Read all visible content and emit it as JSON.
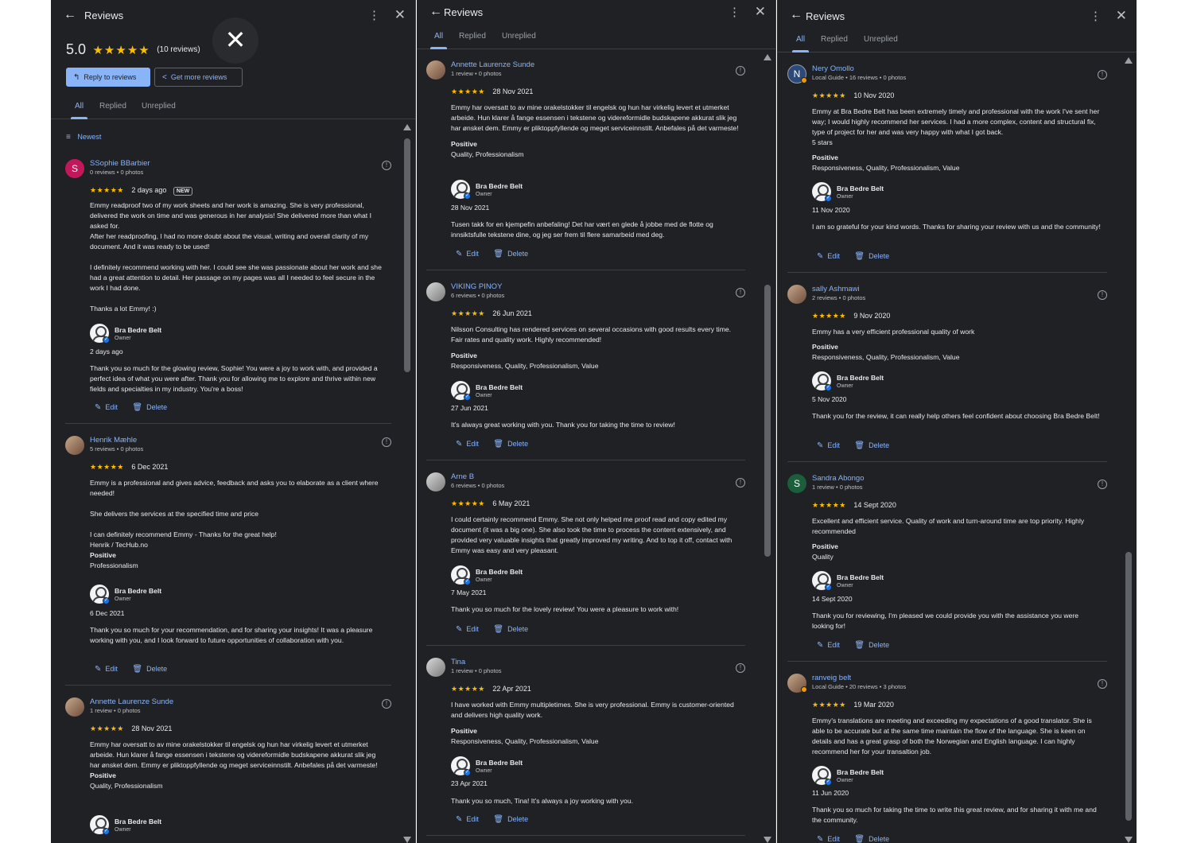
{
  "panel1": {
    "title": "Reviews",
    "icons": {
      "back": "←",
      "more": "⋮",
      "close": "✕"
    },
    "summary": {
      "score": "5.0",
      "stars": "★★★★★",
      "count": "(10 reviews)"
    },
    "buttons": {
      "reply": "Reply to reviews",
      "get_more": "Get more reviews"
    },
    "overlay_close": "✕",
    "tabs": [
      "All",
      "Replied",
      "Unreplied"
    ],
    "sort_label": "Newest",
    "reviews": [
      {
        "initial": "S",
        "name": "SSophie BBarbier",
        "meta": "0 reviews • 0 photos",
        "stars": "★★★★★",
        "date": "2 days ago",
        "badge": "NEW",
        "text1": "Emmy readproof two of my work sheets and her work is amazing. She is very professional, delivered the work on time and was generous in her analysis! She delivered more than what I asked for.",
        "text2": "After her readproofing, I had no more doubt about the visual, writing and overall clarity of my document. And it was ready to be used!",
        "text3": "I definitely recommend working with her. I could see she was passionate about her work and she had a great attention to detail. Her passage on my pages was all I needed to feel secure in the work I had done.",
        "text4": "Thanks a lot Emmy! :)",
        "owner": "Bra Bedre Belt",
        "owner_role": "Owner",
        "reply_date": "2 days ago",
        "reply": "Thank you so much for the glowing review, Sophie! You were a joy to work with, and provided a perfect idea of what you were after. Thank you for allowing me to explore and thrive within new fields and specialties in my industry. You're a boss!",
        "edit": "Edit",
        "delete": "Delete"
      },
      {
        "name": "Henrik Mæhle",
        "meta": "5 reviews • 0 photos",
        "stars": "★★★★★",
        "date": "6 Dec 2021",
        "text1": "Emmy is a professional and gives advice, feedback and asks you to elaborate as a client where needed!",
        "text2": "She delivers the services at the specified time and price",
        "text3": "I can definitely recommend Emmy - Thanks for the great help!",
        "text4": "Henrik / TecHub.no",
        "positive_label": "Positive",
        "positive": "Professionalism",
        "owner": "Bra Bedre Belt",
        "owner_role": "Owner",
        "reply_date": "6 Dec 2021",
        "reply": "Thank you so much for your recommendation, and for sharing your insights! It was a pleasure working with you, and I look forward to future opportunities of collaboration with you.",
        "edit": "Edit",
        "delete": "Delete"
      },
      {
        "name": "Annette Laurenze Sunde",
        "meta": "1 review • 0 photos",
        "stars": "★★★★★",
        "date": "28 Nov 2021",
        "text1": "Emmy har oversatt to av mine orakelstokker til engelsk og hun har virkelig levert et utmerket arbeide. Hun klarer å fange essensen i tekstene og videreformidle budskapene akkurat slik jeg har ønsket dem. Emmy er pliktoppfyllende og meget serviceinnstilt. Anbefales på det varmeste!",
        "positive_label": "Positive",
        "positive": "Quality, Professionalism",
        "owner": "Bra Bedre Belt",
        "owner_role": "Owner"
      }
    ]
  },
  "panel2": {
    "title": "Reviews",
    "icons": {
      "back": "←",
      "more": "⋮",
      "close": "✕"
    },
    "tabs": [
      "All",
      "Replied",
      "Unreplied"
    ],
    "reviews": [
      {
        "name": "Annette Laurenze Sunde",
        "meta": "1 review • 0 photos",
        "stars": "★★★★★",
        "date": "28 Nov 2021",
        "text1": "Emmy har oversatt to av mine orakelstokker til engelsk og hun har virkelig levert et utmerket arbeide. Hun klarer å fange essensen i tekstene og videreformidle budskapene akkurat slik jeg har ønsket dem. Emmy er pliktoppfyllende og meget serviceinnstilt. Anbefales på det varmeste!",
        "positive_label": "Positive",
        "positive": "Quality, Professionalism",
        "owner": "Bra Bedre Belt",
        "owner_role": "Owner",
        "reply_date": "28 Nov 2021",
        "reply": "Tusen takk for en kjempefin anbefaling! Det har vært en glede å jobbe med de flotte og innsiktsfulle tekstene dine, og jeg ser frem til flere samarbeid med deg.",
        "edit": "Edit",
        "delete": "Delete"
      },
      {
        "name": "VIKING PINOY",
        "meta": "6 reviews • 0 photos",
        "stars": "★★★★★",
        "date": "26 Jun 2021",
        "text1": "Nilsson Consulting has rendered services on several occasions with good results every time. Fair rates and quality work. Highly recommended!",
        "positive_label": "Positive",
        "positive": "Responsiveness, Quality, Professionalism, Value",
        "owner": "Bra Bedre Belt",
        "owner_role": "Owner",
        "reply_date": "27 Jun 2021",
        "reply": "It's always great working with you. Thank you for taking the time to review!",
        "edit": "Edit",
        "delete": "Delete"
      },
      {
        "name": "Arne B",
        "meta": "6 reviews • 0 photos",
        "stars": "★★★★★",
        "date": "6 May 2021",
        "text1": "I could certainly recommend Emmy. She not only helped me proof read and copy edited my document (it was a big one). She also took the time to process the content extensively, and provided very valuable insights that greatly improved my writing. And to top it off, contact with Emmy was easy and very pleasant.",
        "owner": "Bra Bedre Belt",
        "owner_role": "Owner",
        "reply_date": "7 May 2021",
        "reply": "Thank you so much for the lovely review! You were a pleasure to work with!",
        "edit": "Edit",
        "delete": "Delete"
      },
      {
        "name": "Tina",
        "meta": "1 review • 0 photos",
        "stars": "★★★★★",
        "date": "22 Apr 2021",
        "text1": "I have worked with Emmy multipletimes. She is very professional. Emmy is customer-oriented and delivers high quality work.",
        "positive_label": "Positive",
        "positive": "Responsiveness, Quality, Professionalism, Value",
        "owner": "Bra Bedre Belt",
        "owner_role": "Owner",
        "reply_date": "23 Apr 2021",
        "reply": "Thank you so much, Tina! It's always a joy working with you.",
        "edit": "Edit",
        "delete": "Delete"
      }
    ]
  },
  "panel3": {
    "title": "Reviews",
    "icons": {
      "back": "←",
      "more": "⋮",
      "close": "✕"
    },
    "tabs": [
      "All",
      "Replied",
      "Unreplied"
    ],
    "reviews": [
      {
        "initial": "N",
        "name": "Nery Omollo",
        "meta": "Local Guide • 16 reviews • 0 photos",
        "stars": "★★★★★",
        "date": "10 Nov 2020",
        "text1": "Emmy at Bra Bedre Belt has been extremely timely and professional with the work I've sent her way; I would highly recommend her services. I had a more complex, content and structural fix, type of project for her and was very happy with what I got back.",
        "text2": "5 stars",
        "positive_label": "Positive",
        "positive": "Responsiveness, Quality, Professionalism, Value",
        "owner": "Bra Bedre Belt",
        "owner_role": "Owner",
        "reply_date": "11 Nov 2020",
        "reply": "I am so grateful for your kind words. Thanks for sharing your review with us and the community!",
        "edit": "Edit",
        "delete": "Delete"
      },
      {
        "name": "sally Ashmawi",
        "meta": "2 reviews • 0 photos",
        "stars": "★★★★★",
        "date": "9 Nov 2020",
        "text1": "Emmy has a very efficient professional quality of work",
        "positive_label": "Positive",
        "positive": "Responsiveness, Quality, Professionalism, Value",
        "owner": "Bra Bedre Belt",
        "owner_role": "Owner",
        "reply_date": "5 Nov 2020",
        "reply": "Thank you for the review, it can really help others feel confident about choosing Bra Bedre Belt!",
        "edit": "Edit",
        "delete": "Delete"
      },
      {
        "initial": "S",
        "name": "Sandra Abongo",
        "meta": "1 review • 0 photos",
        "stars": "★★★★★",
        "date": "14 Sept 2020",
        "text1": "Excellent and efficient service. Quality of work and turn-around time are top priority. Highly recommended",
        "positive_label": "Positive",
        "positive": "Quality",
        "owner": "Bra Bedre Belt",
        "owner_role": "Owner",
        "reply_date": "14 Sept 2020",
        "reply": "Thank you for reviewing, I'm pleased we could provide you with the assistance you were looking for!",
        "edit": "Edit",
        "delete": "Delete"
      },
      {
        "name": "ranveig belt",
        "meta": "Local Guide • 20 reviews • 3 photos",
        "stars": "★★★★★",
        "date": "19 Mar 2020",
        "text1": "Emmy's translations are meeting and exceeding my expectations of a good translator. She is able to be accurate but at the same time maintain the flow of the language. She is keen on details and has a great grasp of both the Norwegian and English language. I can highly recommend her for your transaltion job.",
        "owner": "Bra Bedre Belt",
        "owner_role": "Owner",
        "reply_date": "11 Jun 2020",
        "reply": "Thank you so much for taking the time to write this great review, and for sharing it with me and the community.",
        "edit": "Edit",
        "delete": "Delete"
      }
    ]
  }
}
